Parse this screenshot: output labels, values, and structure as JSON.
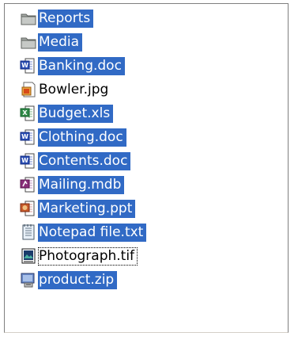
{
  "items": [
    {
      "label": "Reports",
      "icon": "folder-icon",
      "selected": true
    },
    {
      "label": "Media",
      "icon": "folder-icon",
      "selected": true
    },
    {
      "label": "Banking.doc",
      "icon": "word-document-icon",
      "selected": true
    },
    {
      "label": "Bowler.jpg",
      "icon": "jpeg-image-icon",
      "selected": false
    },
    {
      "label": "Budget.xls",
      "icon": "excel-spreadsheet-icon",
      "selected": true
    },
    {
      "label": "Clothing.doc",
      "icon": "word-document-icon",
      "selected": true
    },
    {
      "label": "Contents.doc",
      "icon": "word-document-icon",
      "selected": true
    },
    {
      "label": "Mailing.mdb",
      "icon": "access-database-icon",
      "selected": true
    },
    {
      "label": "Marketing.ppt",
      "icon": "powerpoint-icon",
      "selected": true
    },
    {
      "label": "Notepad file.txt",
      "icon": "text-file-icon",
      "selected": true
    },
    {
      "label": "Photograph.tif",
      "icon": "tiff-image-icon",
      "selected": false,
      "focused": true
    },
    {
      "label": "product.zip",
      "icon": "zip-archive-icon",
      "selected": true
    }
  ],
  "colors": {
    "selection": "#316ac5",
    "selection_text": "#ffffff"
  }
}
